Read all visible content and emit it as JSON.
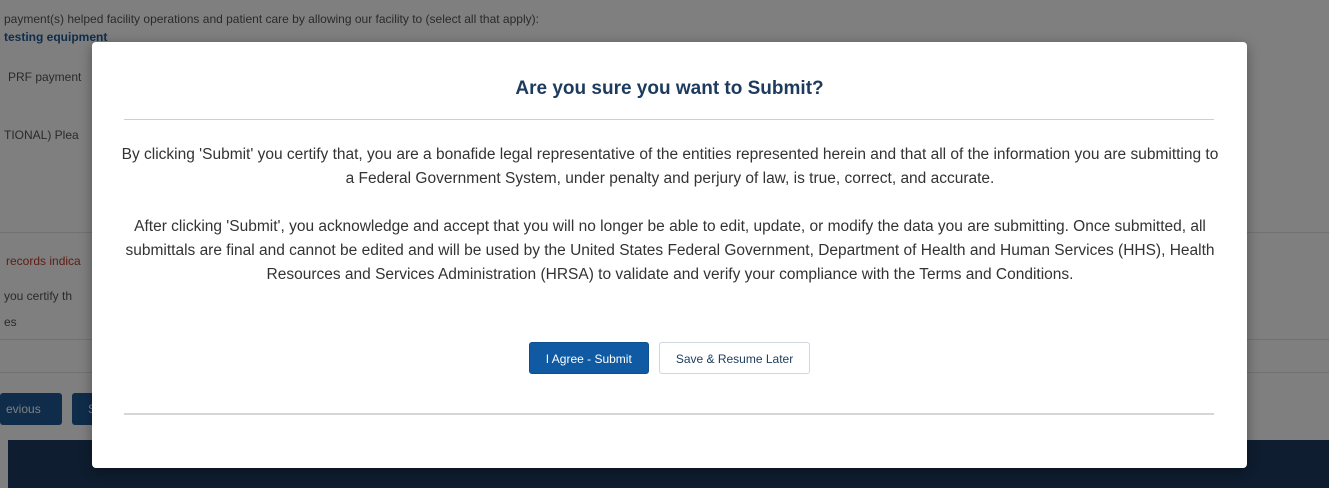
{
  "background": {
    "question_text": "payment(s) helped facility operations and patient care by allowing our facility to (select all that apply):",
    "selected_option": "testing equipment",
    "prf_text": "PRF payment",
    "optional_text": "TIONAL) Plea",
    "records_text": "records indica",
    "certify_text": "you certify th",
    "answer_text": "es",
    "previous_button": "evious",
    "next_button": "S"
  },
  "modal": {
    "title": "Are you sure you want to Submit?",
    "paragraph1": "By clicking 'Submit' you certify that, you are a bonafide legal representative of the entities represented herein and that all of the information you are submitting to a Federal Government System, under penalty and perjury of law, is true, correct, and accurate.",
    "paragraph2": "After clicking 'Submit', you acknowledge and accept that you will no longer be able to edit, update, or modify the data you are submitting. Once submitted, all submittals are final and cannot be edited and will be used by the United States Federal Government, Department of Health and Human Services (HHS), Health Resources and Services Administration (HRSA) to validate and verify your compliance with the Terms and Conditions.",
    "agree_button": "I Agree - Submit",
    "save_button": "Save & Resume Later"
  },
  "colors": {
    "primary": "#0f5aa3",
    "title": "#1c3b5e",
    "footer": "#1c3b5e",
    "overlay": "rgba(0,0,0,0.5)"
  }
}
